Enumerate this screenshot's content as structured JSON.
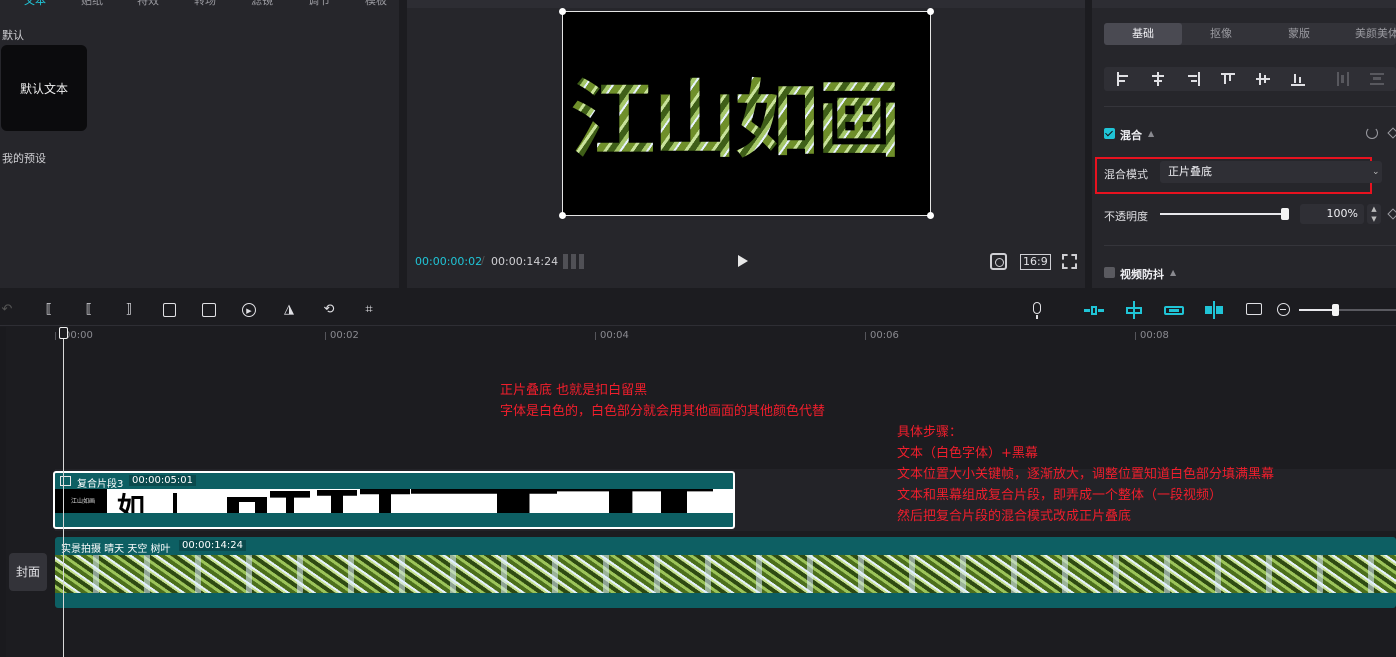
{
  "library": {
    "tabs": [
      "文本",
      "贴纸",
      "特效",
      "转场",
      "滤镜",
      "调节",
      "模板"
    ],
    "active_tab": "文本",
    "default_section": "默认",
    "default_card": "默认文本",
    "preset_section": "我的预设"
  },
  "player": {
    "preview_text": "江山如画",
    "current_time": "00:00:00:02",
    "separator": "/",
    "total_time": "00:00:14:24",
    "ratio": "16:9"
  },
  "inspector": {
    "tabs": [
      "基础",
      "抠像",
      "蒙版",
      "美颜美体"
    ],
    "active_tab": "基础",
    "blend": {
      "title": "混合",
      "checked": true,
      "mode_label": "混合模式",
      "mode_value": "正片叠底"
    },
    "opacity": {
      "label": "不透明度",
      "value": "100%",
      "level": 1.0
    },
    "stabilize": {
      "title": "视频防抖",
      "checked": false
    }
  },
  "timeline": {
    "ruler_labels": [
      "00:00",
      "00:02",
      "00:04",
      "00:06",
      "00:08"
    ],
    "annotation_1": [
      "正片叠底 也就是扣白留黑",
      "字体是白色的，白色部分就会用其他画面的其他颜色代替"
    ],
    "annotation_2": [
      "具体步骤：",
      "文本（白色字体）+黑幕",
      "文本位置大小关键帧，逐渐放大，调整位置知道白色部分填满黑幕",
      "文本和黑幕组成复合片段，即弄成一个整体（一段视频）",
      "然后把复合片段的混合模式改成正片叠底"
    ],
    "compound_clip": {
      "name": "复合片段3",
      "duration": "00:00:05:01",
      "thumb_text": "江山如画",
      "thumb_glyph": "如"
    },
    "video_clip": {
      "name": "实景拍摄 晴天 天空 树叶",
      "duration": "00:00:14:24"
    },
    "cover_label": "封面"
  },
  "colors": {
    "accent": "#20c4d6",
    "highlight_box": "#e8121f",
    "annotation_text": "#f01e2c",
    "clip_teal": "#0d5f63"
  }
}
